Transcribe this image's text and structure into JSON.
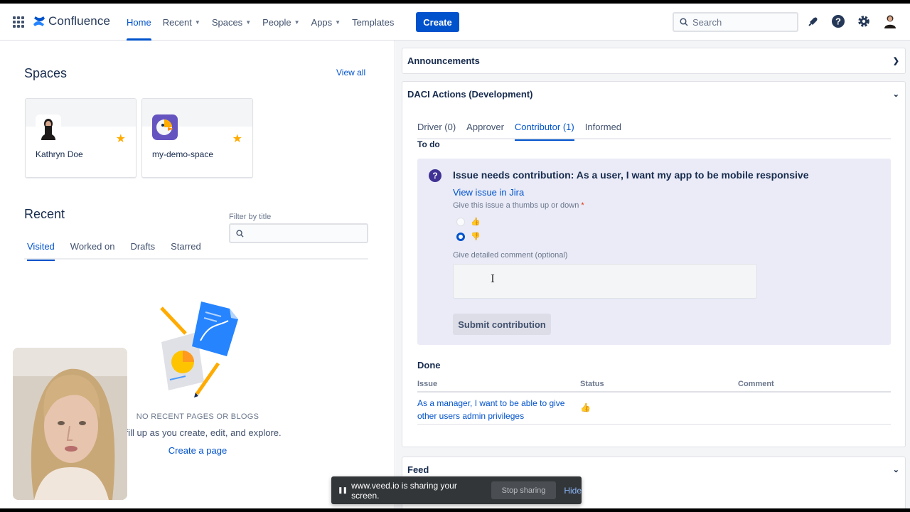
{
  "nav": {
    "app_name": "Confluence",
    "items": [
      {
        "label": "Home",
        "active": true,
        "dropdown": false
      },
      {
        "label": "Recent",
        "active": false,
        "dropdown": true
      },
      {
        "label": "Spaces",
        "active": false,
        "dropdown": true
      },
      {
        "label": "People",
        "active": false,
        "dropdown": true
      },
      {
        "label": "Apps",
        "active": false,
        "dropdown": true
      },
      {
        "label": "Templates",
        "active": false,
        "dropdown": false
      }
    ],
    "create_label": "Create",
    "search_placeholder": "Search",
    "icons": [
      "notifications-icon",
      "help-icon",
      "settings-icon",
      "profile-avatar-icon"
    ]
  },
  "spaces": {
    "title": "Spaces",
    "view_all": "View all",
    "cards": [
      {
        "name": "Kathryn Doe",
        "starred": true,
        "avatar": "person-avatar"
      },
      {
        "name": "my-demo-space",
        "starred": true,
        "avatar": "parrot-logo"
      }
    ]
  },
  "recent": {
    "title": "Recent",
    "filter_label": "Filter by title",
    "tabs": [
      "Visited",
      "Worked on",
      "Drafts",
      "Starred"
    ],
    "active_tab": "Visited",
    "empty_title": "NO RECENT PAGES OR BLOGS",
    "empty_desc": "ill fill up as you create, edit, and explore.",
    "create_link": "Create a page"
  },
  "announcements": {
    "title": "Announcements"
  },
  "daci": {
    "title": "DACI Actions (Development)",
    "tabs": [
      "Driver (0)",
      "Approver",
      "Contributor (1)",
      "Informed"
    ],
    "active_tab": "Contributor (1)",
    "todo_label": "To do",
    "issue": {
      "title": "Issue needs contribution: As a user, I want my app to be mobile responsive",
      "link": "View issue in Jira",
      "thumb_label": "Give this issue a thumbs up or down",
      "required_mark": "*",
      "options": [
        {
          "icon": "👍",
          "checked": false
        },
        {
          "icon": "👎",
          "checked": true
        }
      ],
      "comment_label": "Give detailed comment (optional)",
      "comment_value": "",
      "submit_label": "Submit contribution"
    },
    "done_label": "Done",
    "done_table": {
      "headers": [
        "Issue",
        "Status",
        "Comment"
      ],
      "rows": [
        {
          "issue": "As a manager, I want to be able to give other users admin privileges",
          "status": "👍",
          "comment": ""
        }
      ]
    }
  },
  "feed": {
    "title": "Feed"
  },
  "share_bar": {
    "message": "www.veed.io is sharing your screen.",
    "stop_label": "Stop sharing",
    "hide_label": "Hide"
  },
  "colors": {
    "accent": "#0052cc",
    "star": "#ffab00",
    "issue_bg": "#eaebf7"
  }
}
